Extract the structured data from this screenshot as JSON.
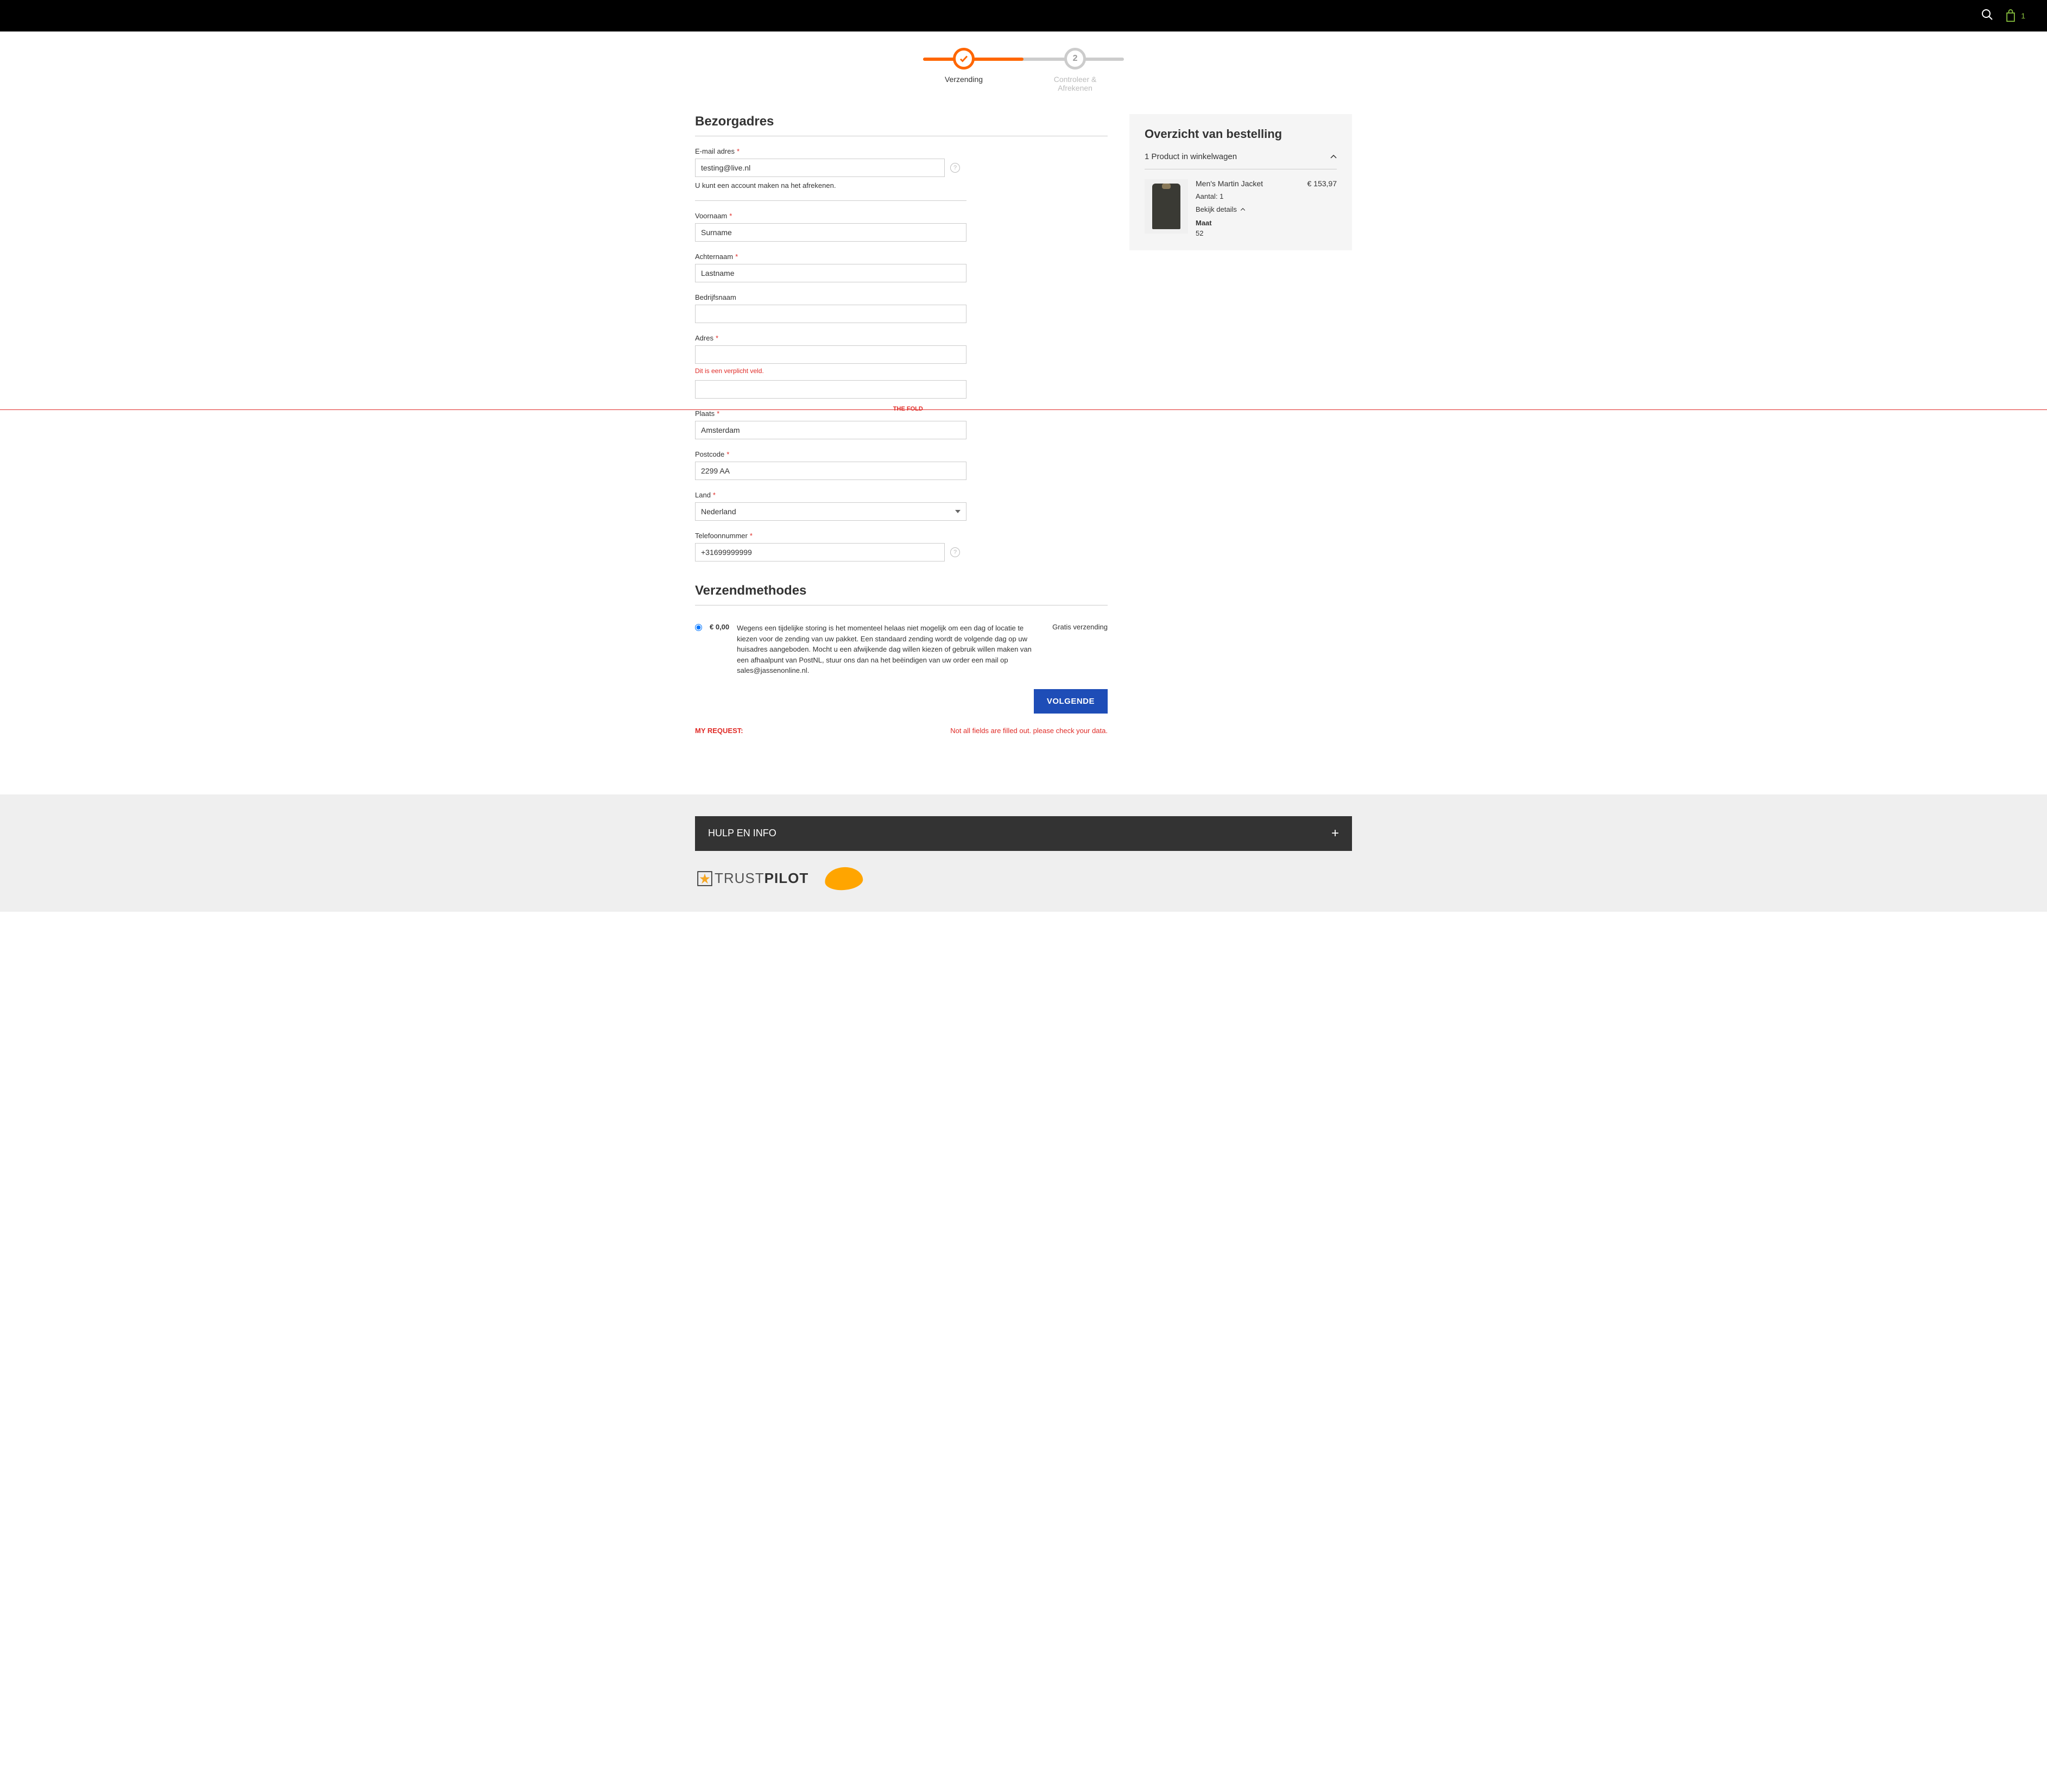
{
  "header": {
    "cart_count": "1"
  },
  "steps": {
    "step1_label": "Verzending",
    "step2_num": "2",
    "step2_label": "Controleer & Afrekenen"
  },
  "form": {
    "title": "Bezorgadres",
    "email_label": "E-mail adres",
    "email_value": "testing@live.nl",
    "email_hint": "U kunt een account maken na het afrekenen.",
    "firstname_label": "Voornaam",
    "firstname_value": "Surname",
    "lastname_label": "Achternaam",
    "lastname_value": "Lastname",
    "company_label": "Bedrijfsnaam",
    "company_value": "",
    "address_label": "Adres",
    "address_value": "",
    "address_error": "Dit is een verplicht veld.",
    "city_label": "Plaats",
    "city_value": "Amsterdam",
    "postcode_label": "Postcode",
    "postcode_value": "2299 AA",
    "country_label": "Land",
    "country_value": "Nederland",
    "phone_label": "Telefoonnummer",
    "phone_value": "+31699999999",
    "required_mark": "*"
  },
  "fold_label": "THE FOLD",
  "shipping": {
    "title": "Verzendmethodes",
    "price": "€ 0,00",
    "desc": "Wegens een tijdelijke storing is het momenteel helaas niet mogelijk om een dag of locatie te kiezen voor de zending van uw pakket. Een standaard zending wordt de volgende dag op uw huisadres aangeboden. Mocht u een afwijkende dag willen kiezen of gebruik willen maken van een afhaalpunt van PostNL, stuur ons dan na het beëindigen van uw order een mail op sales@jassenonline.nl.",
    "type": "Gratis verzending",
    "next_button": "VOLGENDE"
  },
  "anno": {
    "label": "MY REQUEST:",
    "msg": "Not all fields are filled out. please check your data."
  },
  "summary": {
    "title": "Overzicht van bestelling",
    "sub": "1 Product in winkelwagen",
    "item_name": "Men's Martin Jacket",
    "item_price": "€ 153,97",
    "qty_label": "Aantal: 1",
    "details_toggle": "Bekijk details",
    "attr_label": "Maat",
    "attr_value": "52"
  },
  "footer": {
    "help_title": "HULP EN INFO",
    "tp_text_light": "TRUST",
    "tp_text_bold": "PILOT"
  }
}
